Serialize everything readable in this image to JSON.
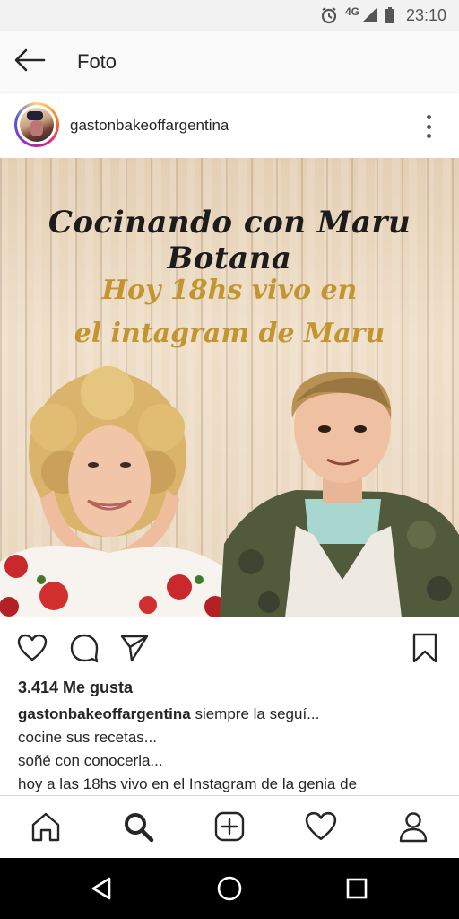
{
  "status_bar": {
    "network": "4G",
    "time": "23:10",
    "icons": [
      "alarm-icon",
      "signal-icon",
      "battery-icon"
    ]
  },
  "app_bar": {
    "title": "Foto",
    "back_icon": "arrow-left-icon"
  },
  "post": {
    "username": "gastonbakeoffargentina",
    "menu_icon": "more-vertical-icon",
    "image": {
      "title": "Cocinando con Maru Botana",
      "subtitle_line1": "Hoy 18hs vivo en",
      "subtitle_line2": "el intagram de Maru"
    },
    "actions": [
      "heart-icon",
      "comment-icon",
      "share-icon",
      "bookmark-icon"
    ],
    "likes": "3.414 Me gusta",
    "caption": {
      "username": "gastonbakeoffargentina",
      "line1": "siempre la seguí...",
      "line2": "cocine sus recetas...",
      "line3": "soñé con conocerla...",
      "line4": "hoy a las 18hs vivo en el Instagram de la genia de"
    }
  },
  "bottom_nav": [
    "home-icon",
    "search-icon",
    "add-icon",
    "activity-icon",
    "profile-icon"
  ],
  "system_nav": [
    "back-triangle-icon",
    "home-circle-icon",
    "recents-square-icon"
  ],
  "colors": {
    "gold_text": "#c2952f",
    "wood": "#e9d6bd",
    "text": "#262626"
  }
}
